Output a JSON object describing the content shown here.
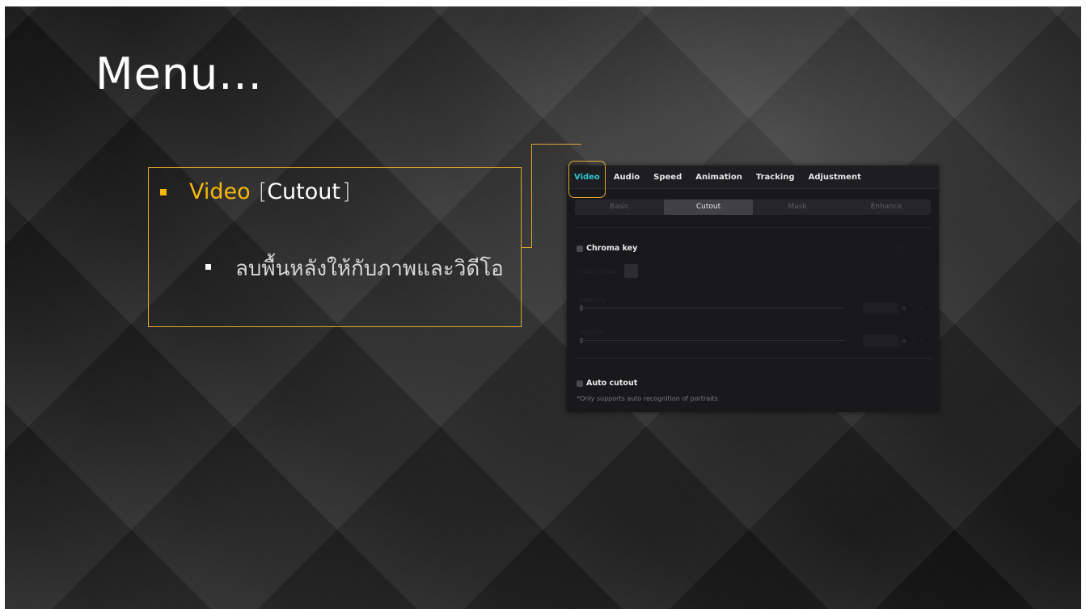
{
  "slide": {
    "title": "Menu...",
    "bullet_video": "Video",
    "bracket_open": "[",
    "bullet_cutout": "Cutout",
    "bracket_close": "]",
    "sub_bullet": "ลบพื้นหลังให้กับภาพและวิดีโอ"
  },
  "panel": {
    "tabs": [
      "Video",
      "Audio",
      "Speed",
      "Animation",
      "Tracking",
      "Adjustment"
    ],
    "active_tab": "Video",
    "subtabs": [
      "Basic",
      "Cutout",
      "Mask",
      "Enhance"
    ],
    "active_subtab": "Cutout",
    "chroma_key_label": "Chroma key",
    "color_picker_label": "Color picker",
    "intensity_label": "Intensity",
    "shadow_label": "Shadow",
    "auto_cutout_label": "Auto cutout",
    "auto_cutout_note": "*Only supports auto recognition of portraits"
  },
  "colors": {
    "accent_yellow": "#f5b800",
    "highlight_border": "#e0a82e",
    "active_tab_teal": "#2ec5cf",
    "panel_bg": "#19191b"
  }
}
